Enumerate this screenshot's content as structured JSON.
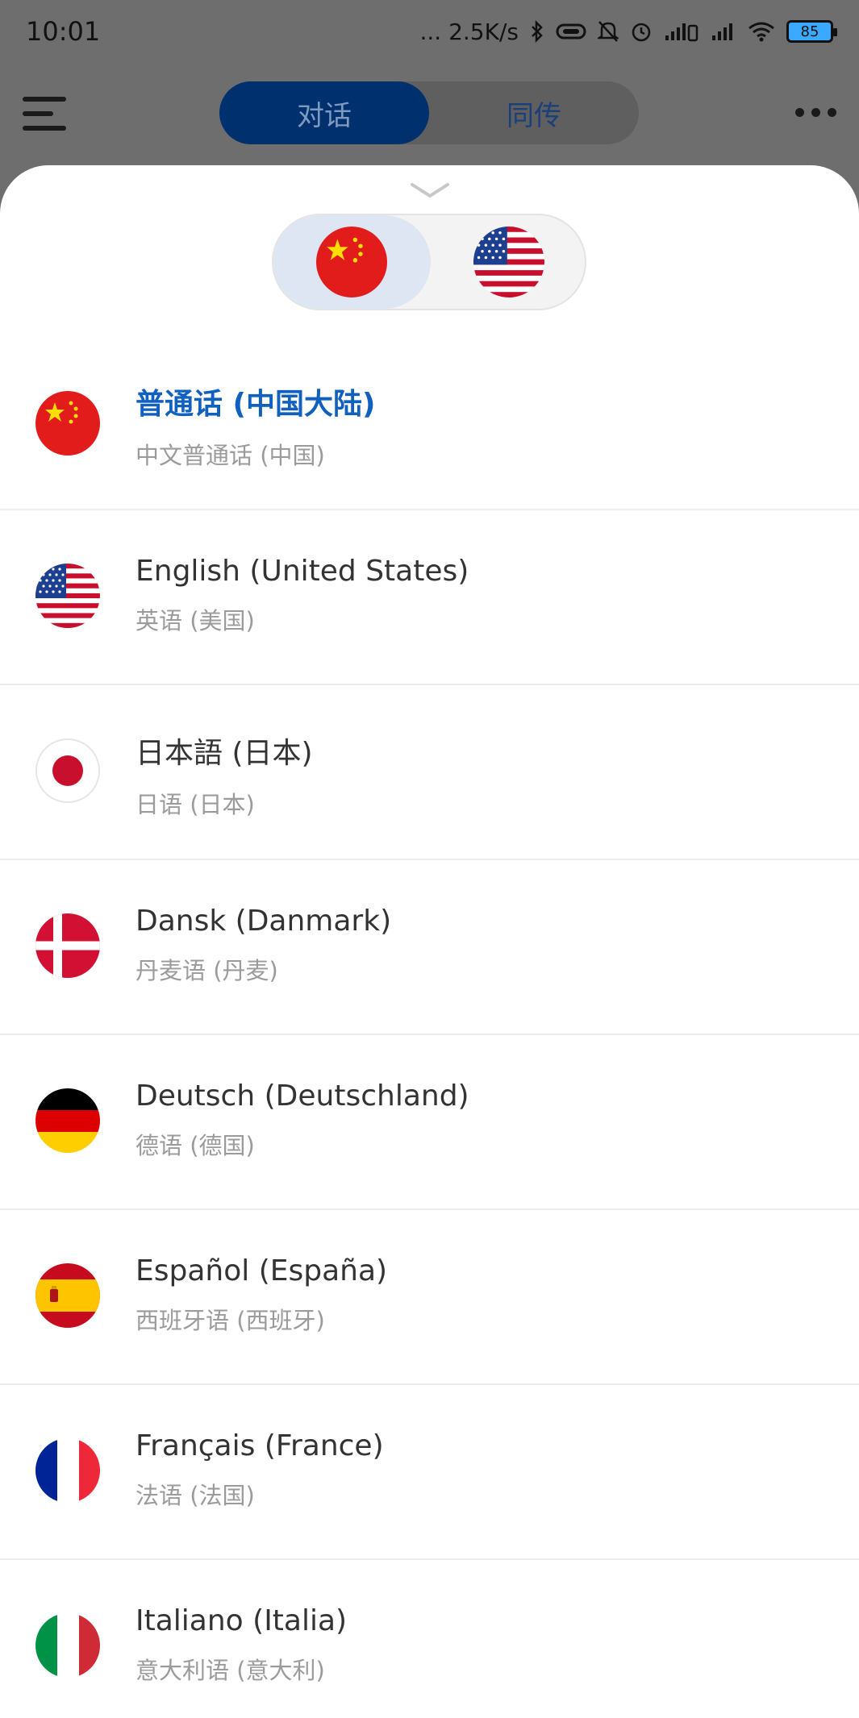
{
  "status_bar": {
    "time": "10:01",
    "network_speed": "... 2.5K/s",
    "battery_level": "85",
    "icons": [
      "bluetooth-icon",
      "vibrate-icon",
      "mute-icon",
      "alarm-icon",
      "signal-icon",
      "signal-icon",
      "wifi-icon",
      "battery-icon"
    ]
  },
  "app_bar": {
    "menu_icon": "menu-icon",
    "tabs": [
      {
        "label": "对话",
        "active": true
      },
      {
        "label": "同传",
        "active": false
      }
    ],
    "more_icon": "more-icon"
  },
  "sheet": {
    "handle_icon": "chevron-down-icon",
    "flag_switch": {
      "left": "cn-flag-icon",
      "right": "us-flag-icon",
      "selected": "left"
    },
    "languages": [
      {
        "name": "普通话 (中国大陆)",
        "sub": "中文普通话 (中国)",
        "flag": "cn-flag-icon",
        "selected": true
      },
      {
        "name": "English (United States)",
        "sub": "英语 (美国)",
        "flag": "us-flag-icon",
        "selected": false
      },
      {
        "name": "日本語 (日本)",
        "sub": "日语 (日本)",
        "flag": "jp-flag-icon",
        "selected": false
      },
      {
        "name": "Dansk (Danmark)",
        "sub": "丹麦语 (丹麦)",
        "flag": "dk-flag-icon",
        "selected": false
      },
      {
        "name": "Deutsch (Deutschland)",
        "sub": "德语 (德国)",
        "flag": "de-flag-icon",
        "selected": false
      },
      {
        "name": "Español (España)",
        "sub": "西班牙语 (西班牙)",
        "flag": "es-flag-icon",
        "selected": false
      },
      {
        "name": "Français (France)",
        "sub": "法语 (法国)",
        "flag": "fr-flag-icon",
        "selected": false
      },
      {
        "name": "Italiano (Italia)",
        "sub": "意大利语 (意大利)",
        "flag": "it-flag-icon",
        "selected": false
      }
    ]
  },
  "colors": {
    "accent_blue": "#1060c0",
    "tab_active_bg": "#00306e",
    "overlay": "#6e6e6e"
  }
}
